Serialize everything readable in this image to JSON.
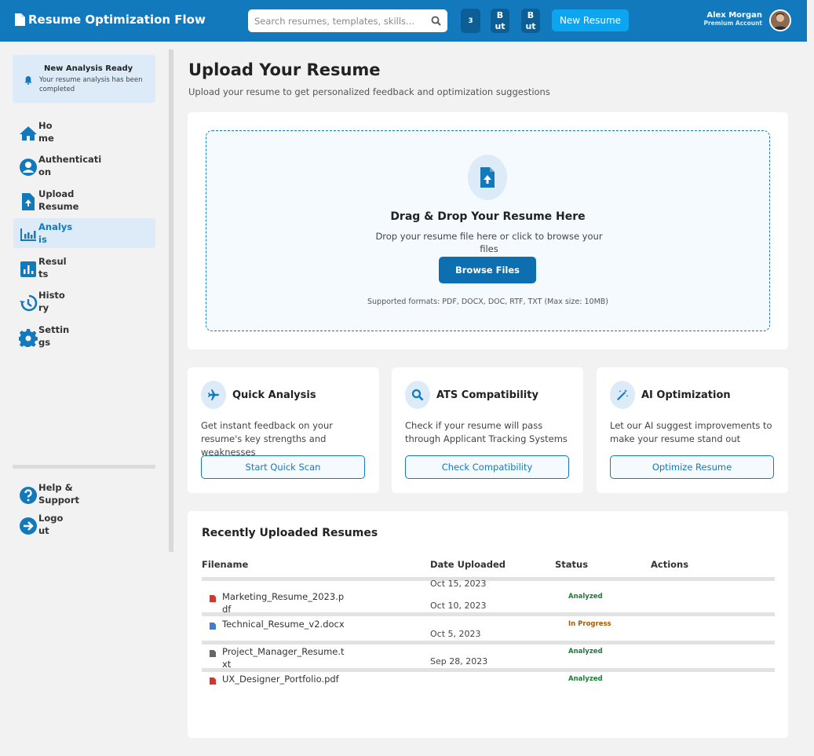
{
  "app": {
    "title": "Resume Optimization Flow"
  },
  "search": {
    "placeholder": "Search resumes, templates, skills..."
  },
  "header": {
    "badge_count": "3",
    "but1": "But",
    "but2": "But",
    "new_resume": "New Resume",
    "user_name": "Alex Morgan",
    "user_role": "Premium Account"
  },
  "notice": {
    "title": "New Analysis Ready",
    "text": "Your resume analysis has been completed"
  },
  "sidebar": {
    "items": [
      {
        "label": "Home",
        "icon": "home-icon"
      },
      {
        "label": "Authentication",
        "icon": "user-circle-icon"
      },
      {
        "label": "Upload Resume",
        "icon": "file-upload-icon"
      },
      {
        "label": "Analysis",
        "icon": "analytics-icon",
        "active": true
      },
      {
        "label": "Results",
        "icon": "bar-chart-icon"
      },
      {
        "label": "History",
        "icon": "history-icon"
      },
      {
        "label": "Settings",
        "icon": "gear-icon"
      }
    ],
    "footer": [
      {
        "label": "Help & Support",
        "icon": "help-icon"
      },
      {
        "label": "Logout",
        "icon": "logout-icon"
      }
    ]
  },
  "page": {
    "title": "Upload Your Resume",
    "subtitle": "Upload your resume to get personalized feedback and optimization suggestions"
  },
  "upload": {
    "title": "Drag & Drop Your Resume Here",
    "subtitle": "Drop your resume file here or click to browse your files",
    "button": "Browse Files",
    "formats": "Supported formats: PDF, DOCX, DOC, RTF, TXT (Max size: 10MB)"
  },
  "features": [
    {
      "title": "Quick Analysis",
      "desc": "Get instant feedback on your resume's key strengths and weaknesses",
      "button": "Start Quick Scan",
      "icon": "airplane-icon"
    },
    {
      "title": "ATS Compatibility",
      "desc": "Check if your resume will pass through Applicant Tracking Systems",
      "button": "Check Compatibility",
      "icon": "search-icon"
    },
    {
      "title": "AI Optimization",
      "desc": "Let our AI suggest improvements to make your resume stand out",
      "button": "Optimize Resume",
      "icon": "magic-wand-icon"
    }
  ],
  "recent": {
    "title": "Recently Uploaded Resumes",
    "headers": [
      "Filename",
      "Date Uploaded",
      "Status",
      "Actions"
    ],
    "rows": [
      {
        "file": "Marketing_Resume_2023.pdf",
        "date": "Oct 15, 2023",
        "status": "Analyzed",
        "type": "pdf"
      },
      {
        "file": "Technical_Resume_v2.docx",
        "date": "Oct 10, 2023",
        "status": "In Progress",
        "type": "docx"
      },
      {
        "file": "Project_Manager_Resume.txt",
        "date": "Oct 5, 2023",
        "status": "Analyzed",
        "type": "txt"
      },
      {
        "file": "UX_Designer_Portfolio.pdf",
        "date": "Sep 28, 2023",
        "status": "Analyzed",
        "type": "pdf"
      }
    ]
  },
  "colors": {
    "primary": "#1379bd",
    "accent": "#0ea5f0",
    "analyzed": "#1e7a3a",
    "in_progress": "#a65b00",
    "pdf": "#d9342b",
    "docx": "#3b7dd8",
    "txt": "#666666"
  }
}
